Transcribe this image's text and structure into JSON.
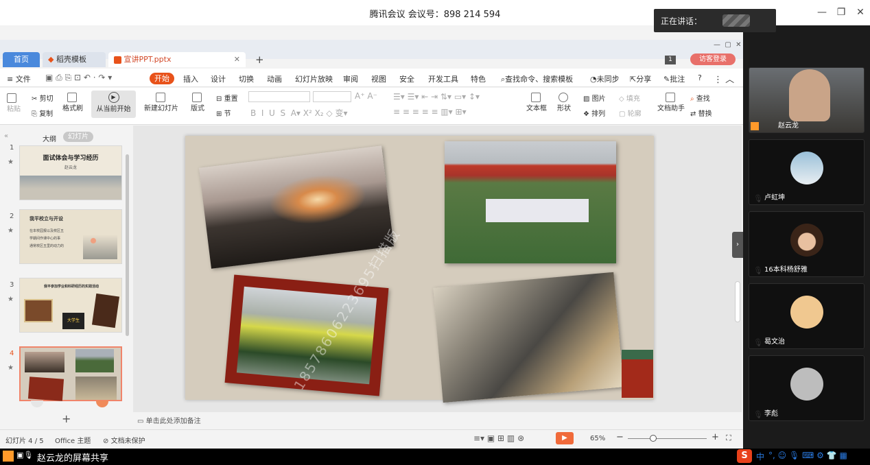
{
  "meeting": {
    "title": "腾讯会议 会议号：898 214 594",
    "speaking_label": "正在讲话："
  },
  "window_controls": {
    "minimize": "—",
    "maximize": "❐",
    "close": "✕"
  },
  "tabs": {
    "home": "首页",
    "template": "稻壳模板",
    "file": "宣讲PPT.pptx",
    "new_tab": "+"
  },
  "header_right": {
    "page_badge": "1",
    "login": "访客登录"
  },
  "menu": {
    "file": "文件",
    "items": [
      "开始",
      "插入",
      "设计",
      "切换",
      "动画",
      "幻灯片放映",
      "审阅",
      "视图",
      "安全",
      "开发工具",
      "特色"
    ],
    "search": "查找命令、搜索模板",
    "sync": "未同步",
    "share": "分享",
    "comment": "批注",
    "help": "?"
  },
  "ribbon": {
    "paste": "粘贴",
    "cut": "剪切",
    "copy": "复制",
    "format_painter": "格式刷",
    "play_from_current": "从当前开始",
    "new_slide": "新建幻灯片",
    "layout": "版式",
    "reset": "重置",
    "section": "节",
    "textbox": "文本框",
    "shape": "形状",
    "picture": "图片",
    "fill": "填充",
    "arrange": "排列",
    "outline": "轮廓",
    "doc_helper": "文档助手",
    "find": "查找",
    "replace": "替换"
  },
  "sidepane": {
    "outline_tab": "大纲",
    "slides_tab": "幻灯片",
    "add": "+",
    "slides": [
      {
        "num": "1",
        "title": "面试体会与学习经历",
        "subtitle": "赵云龙"
      },
      {
        "num": "2",
        "title": "我平校立与开设",
        "lines": [
          "在本校园报以及校区五",
          "学期间作课中心的事",
          "通常校区五里的动力的"
        ]
      },
      {
        "num": "3",
        "title": "我平参加学业和科研经历的实践活动",
        "caption": "大学生"
      },
      {
        "num": "4"
      }
    ]
  },
  "slide": {
    "watermark": "18578606223695扫描版"
  },
  "notes": {
    "placeholder": "单击此处添加备注"
  },
  "status": {
    "slide_count": "幻灯片 4 / 5",
    "theme": "Office 主题",
    "protect": "文档未保护",
    "zoom": "65%"
  },
  "participants": [
    {
      "name": "赵云龙"
    },
    {
      "name": "卢虹坤"
    },
    {
      "name": "16本科杨舒雅"
    },
    {
      "name": "曷文治"
    },
    {
      "name": "李彪"
    }
  ],
  "bottom": {
    "share_label": "赵云龙的屏幕共享",
    "ime": "中"
  }
}
